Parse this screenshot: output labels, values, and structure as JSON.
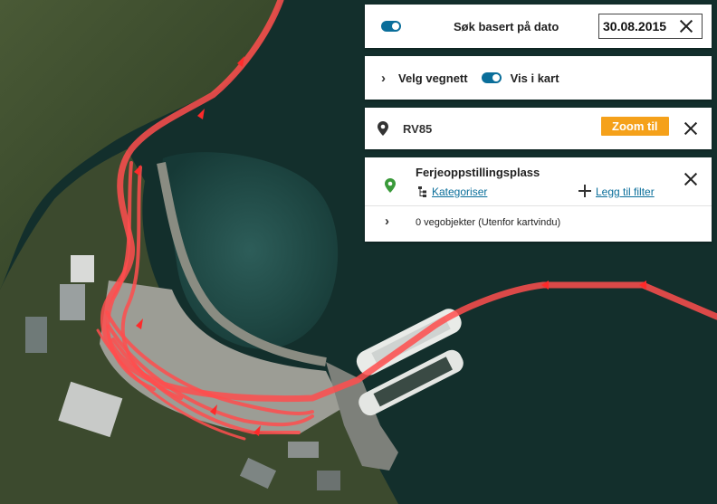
{
  "date_search": {
    "label": "Søk basert på dato",
    "value": "30.08.2015",
    "toggle_on": true
  },
  "network": {
    "expand_label": "Velg vegnett",
    "show_on_map_label": "Vis i kart",
    "toggle_on": true
  },
  "road": {
    "name": "RV85",
    "zoom_button": "Zoom til"
  },
  "object_type": {
    "name": "Ferjeoppstillingsplass",
    "categorize_link": "Kategoriser",
    "add_filter_link": "Legg til filter",
    "count_text": "0 vegobjekter (Utenfor kartvindu)"
  },
  "colors": {
    "accent": "#0a6e9a",
    "zoom_button": "#f5a11a",
    "marker_green": "#3a9a3a",
    "road_line": "#ff4d4d",
    "water": "#143532",
    "land": "#2f3f26"
  },
  "icons": [
    "toggle-icon",
    "close-icon",
    "chevron-right-icon",
    "location-pin-icon",
    "hierarchy-icon",
    "plus-icon"
  ]
}
